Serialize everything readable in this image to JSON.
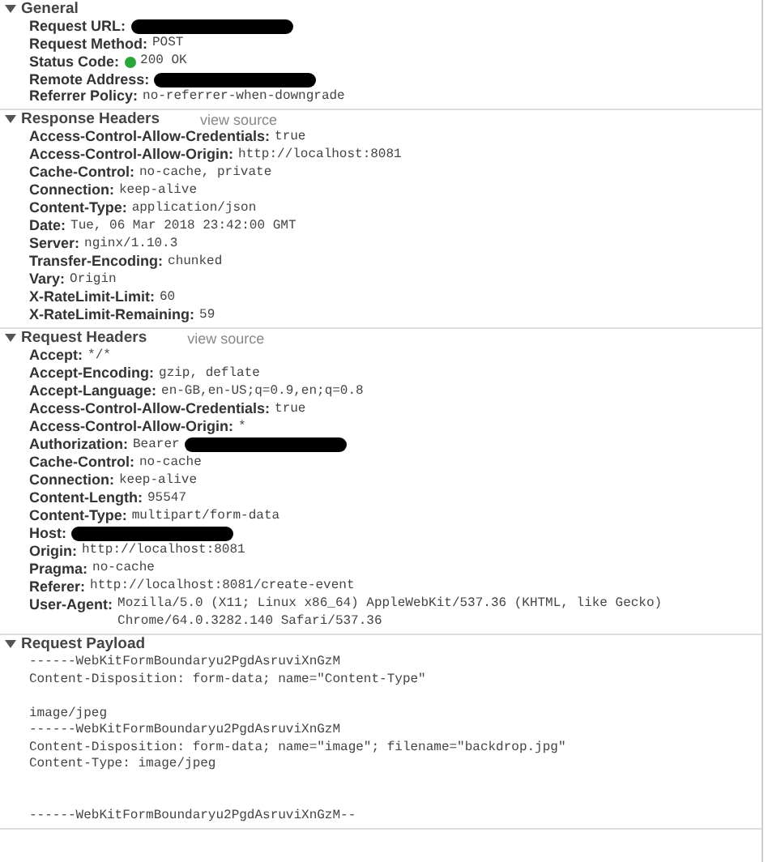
{
  "sections": [
    {
      "title": "General",
      "expanded": true,
      "rows": [
        {
          "name": "Request URL:",
          "redacted": true
        },
        {
          "name": "Request Method:",
          "value": "POST"
        },
        {
          "name": "Status Code:",
          "value": "200 OK",
          "color": "#2aa53a"
        },
        {
          "name": "Remote Address:",
          "redacted": true
        },
        {
          "name": "Referrer Policy:",
          "value": "no-referrer-when-downgrade"
        }
      ]
    },
    {
      "title": "Response Headers",
      "expanded": true,
      "link": "view source",
      "rows": [
        {
          "name": "Access-Control-Allow-Credentials:",
          "value": "true"
        },
        {
          "name": "Access-Control-Allow-Origin:",
          "value": "http://localhost:8081"
        },
        {
          "name": "Cache-Control:",
          "value": "no-cache, private"
        },
        {
          "name": "Connection:",
          "value": "keep-alive"
        },
        {
          "name": "Content-Type:",
          "value": "application/json"
        },
        {
          "name": "Date:",
          "value": "Tue, 06 Mar 2018 23:42:00 GMT"
        },
        {
          "name": "Server:",
          "value": "nginx/1.10.3"
        },
        {
          "name": "Transfer-Encoding:",
          "value": "chunked"
        },
        {
          "name": "Vary:",
          "value": "Origin"
        },
        {
          "name": "X-RateLimit-Limit:",
          "value": "60"
        },
        {
          "name": "X-RateLimit-Remaining:",
          "value": "59"
        }
      ]
    },
    {
      "title": "Request Headers",
      "expanded": true,
      "link": "view source",
      "rows": [
        {
          "name": "Accept:",
          "value": "*/*"
        },
        {
          "name": "Accept-Encoding:",
          "value": "gzip, deflate"
        },
        {
          "name": "Accept-Language:",
          "value": "en-GB,en-US;q=0.9,en;q=0.8"
        },
        {
          "name": "Access-Control-Allow-Credentials:",
          "value": "true"
        },
        {
          "name": "Access-Control-Allow-Origin:",
          "value": "*"
        },
        {
          "name": "Authorization:",
          "value": "Bearer",
          "redacted": true
        },
        {
          "name": "Cache-Control:",
          "value": "no-cache"
        },
        {
          "name": "Connection:",
          "value": "keep-alive"
        },
        {
          "name": "Content-Length:",
          "value": "95547"
        },
        {
          "name": "Content-Type:",
          "value": "multipart/form-data"
        },
        {
          "name": "Host:",
          "redacted": true
        },
        {
          "name": "Origin:",
          "value": "http://localhost:8081"
        },
        {
          "name": "Pragma:",
          "value": "no-cache"
        },
        {
          "name": "Referer:",
          "value": "http://localhost:8081/create-event"
        },
        {
          "name": "User-Agent:",
          "value": "Mozilla/5.0 (X11; Linux x86_64) AppleWebKit/537.36 (KHTML, like Gecko) Chrome/64.0.3282.140 Safari/537.36"
        }
      ]
    },
    {
      "title": "Request Payload",
      "expanded": true,
      "payload": "------WebKitFormBoundaryu2PgdAsruviXnGzM\nContent-Disposition: form-data; name=\"Content-Type\"\n\nimage/jpeg\n------WebKitFormBoundaryu2PgdAsruviXnGzM\nContent-Disposition: form-data; name=\"image\"; filename=\"backdrop.jpg\"\nContent-Type: image/jpeg\n\n\n------WebKitFormBoundaryu2PgdAsruviXnGzM--"
    }
  ]
}
